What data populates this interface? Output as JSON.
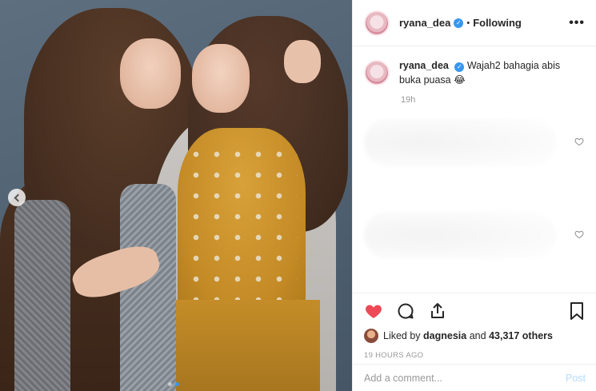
{
  "header": {
    "username": "ryana_dea",
    "separator": "•",
    "follow_status": "Following",
    "more_label": "•••"
  },
  "caption": {
    "username": "ryana_dea",
    "text": "Wajah2 bahagia abis buka puasa",
    "emoji": "😂",
    "time": "19h"
  },
  "likes": {
    "liked_by_prefix": "Liked by",
    "liked_by_user": "dagnesia",
    "and": "and",
    "count_text": "43,317 others"
  },
  "post_time": "19 HOURS AGO",
  "comment_box": {
    "placeholder": "Add a comment...",
    "post_label": "Post"
  },
  "icons": {
    "like": "heart-filled-icon",
    "comment": "speech-bubble-icon",
    "share": "share-icon",
    "save": "bookmark-icon",
    "verified": "verified-badge-icon",
    "carousel_prev": "chevron-left-icon"
  },
  "colors": {
    "like_red": "#ed4956",
    "verified_blue": "#3897f0",
    "post_button_disabled": "#b3dbff",
    "muted_text": "#999999"
  }
}
